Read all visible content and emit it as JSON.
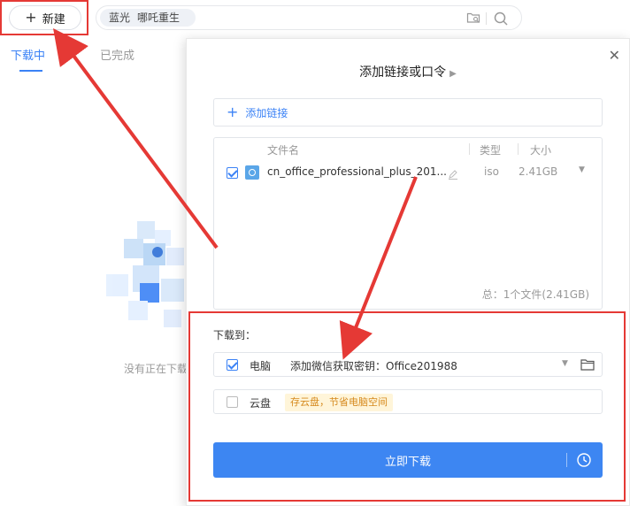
{
  "topbar": {
    "new_label": "新建",
    "search_tag_1": "蓝光",
    "search_tag_2": "哪吒重生"
  },
  "tabs": [
    {
      "label": "下载中",
      "active": true
    },
    {
      "label": "已完成",
      "active": false
    }
  ],
  "empty_state": {
    "text": "没有正在下载"
  },
  "dialog": {
    "title": "添加链接或口令",
    "add_link_label": "添加链接",
    "columns": {
      "name": "文件名",
      "type": "类型",
      "size": "大小"
    },
    "file": {
      "name": "cn_office_professional_plus_201...",
      "type": "iso",
      "size": "2.41GB",
      "checked": true
    },
    "total": "总：1个文件(2.41GB)",
    "download_to_label": "下载到：",
    "pc": {
      "label": "电脑",
      "path": "添加微信获取密钥：Office201988",
      "checked": true
    },
    "cloud": {
      "label": "云盘",
      "hint": "存云盘，节省电脑空间",
      "checked": false
    },
    "download_button": "立即下载"
  },
  "colors": {
    "accent": "#3d86f2",
    "annotation_red": "#e53935",
    "hint_bg": "#fff5d9",
    "hint_text": "#d68a1e"
  }
}
